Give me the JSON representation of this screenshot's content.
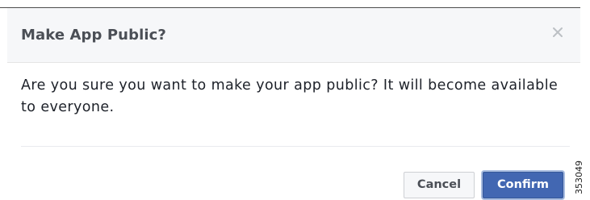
{
  "dialog": {
    "title": "Make App Public?",
    "message": "Are you sure you want to make your app public? It will become available to everyone.",
    "cancel_label": "Cancel",
    "confirm_label": "Confirm",
    "close_icon": "close-icon"
  },
  "figure_id": "353049",
  "colors": {
    "header_bg": "#f6f7f9",
    "primary_button": "#4267b2",
    "title_text": "#4b4f56",
    "body_text": "#1d2129"
  }
}
